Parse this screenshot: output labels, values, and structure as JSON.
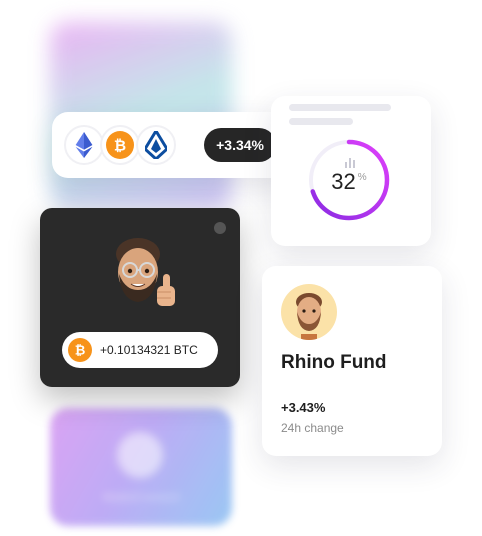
{
  "coin_card": {
    "coins": [
      {
        "name": "ethereum-icon",
        "color": "#627eea"
      },
      {
        "name": "bitcoin-icon",
        "color": "#f7931a"
      },
      {
        "name": "lisk-icon",
        "color": "#0d4ea0"
      }
    ],
    "change": "+3.34%"
  },
  "gauge": {
    "value": "32",
    "unit": "%",
    "fraction": 0.7,
    "gradient": [
      "#8a2be2",
      "#e040fb"
    ]
  },
  "wallet_card": {
    "balance": "+0.10134321 BTC"
  },
  "fund_card": {
    "name": "Rhino Fund",
    "change": "+3.43%",
    "change_label": "24h change"
  },
  "blurred_card": {
    "label": "WalletConnect"
  }
}
